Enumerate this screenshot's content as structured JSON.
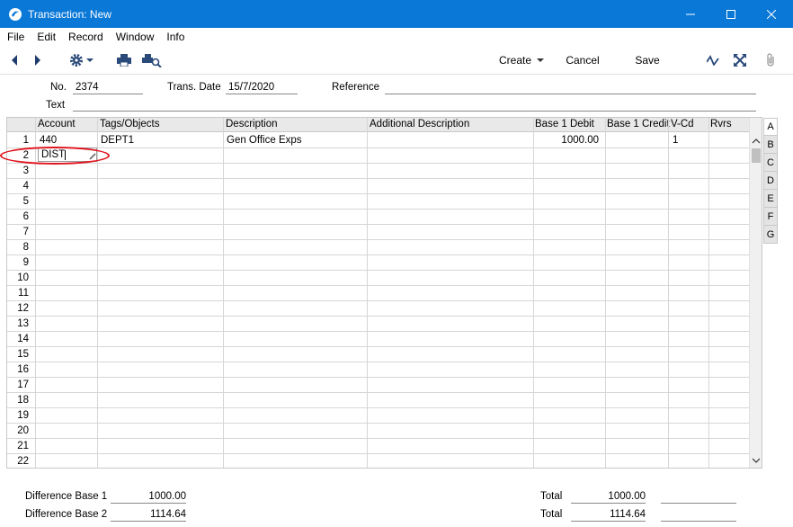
{
  "window": {
    "title": "Transaction: New",
    "min_icon": "minimize-icon",
    "max_icon": "maximize-icon",
    "close_icon": "close-icon"
  },
  "menu": [
    "File",
    "Edit",
    "Record",
    "Window",
    "Info"
  ],
  "toolbar": {
    "create_label": "Create",
    "cancel_label": "Cancel",
    "save_label": "Save"
  },
  "header": {
    "no_label": "No.",
    "no_value": "2374",
    "date_label": "Trans. Date",
    "date_value": "15/7/2020",
    "reference_label": "Reference",
    "reference_value": "",
    "text_label": "Text",
    "text_value": ""
  },
  "grid": {
    "columns": [
      "Account",
      "Tags/Objects",
      "Description",
      "Additional Description",
      "Base 1 Debit",
      "Base 1 Credit",
      "V-Cd",
      "Rvrs"
    ],
    "rows": [
      {
        "num": "1",
        "account": "440",
        "tags": "DEPT1",
        "description": "Gen Office Exps",
        "additional": "",
        "debit": "1000.00",
        "credit": "",
        "vcd": "1",
        "rvrs": ""
      },
      {
        "num": "2",
        "account": "DIST",
        "tags": "",
        "description": "",
        "additional": "",
        "debit": "",
        "credit": "",
        "vcd": "",
        "rvrs": ""
      },
      {
        "num": "3"
      },
      {
        "num": "4"
      },
      {
        "num": "5"
      },
      {
        "num": "6"
      },
      {
        "num": "7"
      },
      {
        "num": "8"
      },
      {
        "num": "9"
      },
      {
        "num": "10"
      },
      {
        "num": "11"
      },
      {
        "num": "12"
      },
      {
        "num": "13"
      },
      {
        "num": "14"
      },
      {
        "num": "15"
      },
      {
        "num": "16"
      },
      {
        "num": "17"
      },
      {
        "num": "18"
      },
      {
        "num": "19"
      },
      {
        "num": "20"
      },
      {
        "num": "21"
      },
      {
        "num": "22"
      }
    ]
  },
  "tabs": [
    "A",
    "B",
    "C",
    "D",
    "E",
    "F",
    "G"
  ],
  "footer": {
    "diff1_label": "Difference Base 1",
    "diff1_value": "1000.00",
    "diff2_label": "Difference Base 2",
    "diff2_value": "1114.64",
    "total_label": "Total",
    "total1_value": "1000.00",
    "total2_value": "1114.64"
  }
}
